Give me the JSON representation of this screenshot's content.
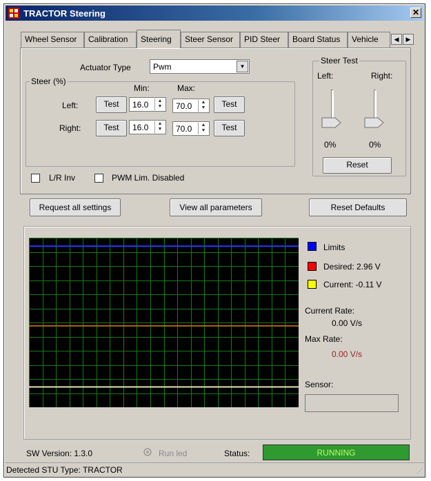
{
  "window": {
    "title": "TRACTOR Steering",
    "close_glyph": "✕"
  },
  "tabs": [
    {
      "label": "Wheel Sensor"
    },
    {
      "label": "Calibration"
    },
    {
      "label": "Steering"
    },
    {
      "label": "Steer Sensor"
    },
    {
      "label": "PID Steer"
    },
    {
      "label": "Board Status"
    },
    {
      "label": "Vehicle"
    }
  ],
  "tab_scroll": {
    "left": "◀",
    "right": "▶"
  },
  "steering": {
    "actuator_type_label": "Actuator Type",
    "actuator_type_value": "Pwm",
    "steer_group_label": "Steer (%)",
    "min_label": "Min:",
    "max_label": "Max:",
    "left_label": "Left:",
    "right_label": "Right:",
    "test_label": "Test",
    "left_min": "16.0",
    "left_max": "70.0",
    "right_min": "16.0",
    "right_max": "70.0",
    "lr_inv_label": "L/R Inv",
    "pwm_lim_label": "PWM Lim. Disabled"
  },
  "steer_test": {
    "group_label": "Steer Test",
    "left_label": "Left:",
    "right_label": "Right:",
    "left_value": "0%",
    "right_value": "0%",
    "reset_label": "Reset"
  },
  "actions": {
    "request_all": "Request all settings",
    "view_params": "View all parameters",
    "reset_defaults": "Reset Defaults"
  },
  "legend": {
    "limits": "Limits",
    "desired": "Desired: 2.96 V",
    "current": "Current: -0.11 V",
    "limits_color": "#0000ff",
    "desired_color": "#ff0000",
    "current_color": "#ffff00"
  },
  "rates": {
    "current_rate_label": "Current Rate:",
    "current_rate_value": "0.00 V/s",
    "max_rate_label": "Max Rate:",
    "max_rate_value": "0.00 V/s",
    "max_rate_color": "#a02020"
  },
  "sensor": {
    "label": "Sensor:",
    "value": ""
  },
  "footer": {
    "sw_version": "SW Version: 1.3.0",
    "run_led_label": "Run led",
    "status_label": "Status:",
    "status_value": "RUNNING",
    "status_color": "#2f9a2f"
  },
  "statusbar": {
    "text": "Detected STU Type: TRACTOR"
  },
  "chart_data": {
    "type": "line",
    "title": "",
    "xlabel": "",
    "ylabel": "",
    "grid": true,
    "background": "#000000",
    "grid_color": "#1a7a1a",
    "series": [
      {
        "name": "Limits",
        "color": "#1e3cff",
        "values": [
          0.95
        ]
      },
      {
        "name": "Desired",
        "color": "#b46414",
        "values": [
          0.48
        ]
      },
      {
        "name": "Current",
        "color": "#e6e6b4",
        "values": [
          0.12
        ]
      }
    ],
    "ylim": [
      0,
      1
    ]
  }
}
